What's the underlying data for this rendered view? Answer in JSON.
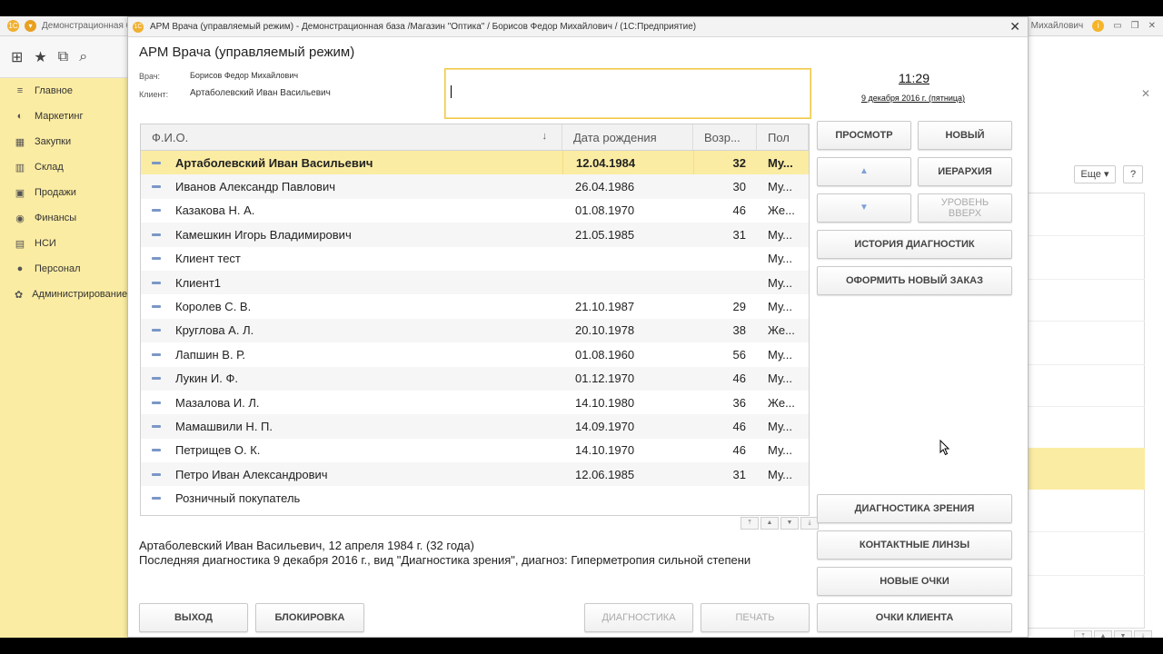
{
  "bg_window": {
    "title": "Демонстрационная б",
    "user": "Михайлович",
    "more": "Еще",
    "help": "?",
    "sidebar": [
      {
        "icon": "≡",
        "label": "Главное"
      },
      {
        "icon": "◐",
        "label": "Маркетинг"
      },
      {
        "icon": "▦",
        "label": "Закупки"
      },
      {
        "icon": "▥",
        "label": "Склад"
      },
      {
        "icon": "▣",
        "label": "Продажи"
      },
      {
        "icon": "◉",
        "label": "Финансы"
      },
      {
        "icon": "▤",
        "label": "НСИ"
      },
      {
        "icon": "●",
        "label": "Персонал"
      },
      {
        "icon": "✿",
        "label": "Администрирование"
      }
    ]
  },
  "modal": {
    "window_title": "АРМ Врача (управляемый режим) - Демонстрационная база /Магазин \"Оптика\" / Борисов Федор Михайлович /  (1С:Предприятие)",
    "form_title": "АРМ Врача (управляемый режим)",
    "doctor_label": "Врач:",
    "doctor_value": "Борисов Федор Михайлович",
    "client_label": "Клиент:",
    "client_value": "Артаболевский Иван Васильевич",
    "time": "11:29",
    "date": "9 декабря 2016 г. (пятница)"
  },
  "table": {
    "columns": [
      "Ф.И.О.",
      "Дата рождения",
      "Возр...",
      "Пол"
    ],
    "rows": [
      {
        "name": "Артаболевский Иван Васильевич",
        "birth": "12.04.1984",
        "age": "32",
        "sex": "Му...",
        "selected": true
      },
      {
        "name": "Иванов Александр Павлович",
        "birth": "26.04.1986",
        "age": "30",
        "sex": "Му..."
      },
      {
        "name": "Казакова Н. А.",
        "birth": "01.08.1970",
        "age": "46",
        "sex": "Же..."
      },
      {
        "name": "Камешкин Игорь Владимирович",
        "birth": "21.05.1985",
        "age": "31",
        "sex": "Му..."
      },
      {
        "name": "Клиент тест",
        "birth": "",
        "age": "",
        "sex": "Му..."
      },
      {
        "name": "Клиент1",
        "birth": "",
        "age": "",
        "sex": "Му..."
      },
      {
        "name": "Королев С. В.",
        "birth": "21.10.1987",
        "age": "29",
        "sex": "Му..."
      },
      {
        "name": "Круглова А. Л.",
        "birth": "20.10.1978",
        "age": "38",
        "sex": "Же..."
      },
      {
        "name": "Лапшин В. Р.",
        "birth": "01.08.1960",
        "age": "56",
        "sex": "Му..."
      },
      {
        "name": "Лукин И. Ф.",
        "birth": "01.12.1970",
        "age": "46",
        "sex": "Му..."
      },
      {
        "name": "Мазалова И. Л.",
        "birth": "14.10.1980",
        "age": "36",
        "sex": "Же..."
      },
      {
        "name": "Мамашвили Н. П.",
        "birth": "14.09.1970",
        "age": "46",
        "sex": "Му..."
      },
      {
        "name": "Петрищев О. К.",
        "birth": "14.10.1970",
        "age": "46",
        "sex": "Му..."
      },
      {
        "name": "Петро Иван Александрович",
        "birth": "12.06.1985",
        "age": "31",
        "sex": "Му..."
      },
      {
        "name": "Розничный покупатель",
        "birth": "",
        "age": "",
        "sex": ""
      }
    ]
  },
  "summary": {
    "line1": "Артаболевский Иван Васильевич, 12 апреля 1984 г. (32 года)",
    "line2": "Последняя диагностика 9 декабря 2016 г., вид \"Диагностика зрения\", диагноз: Гиперметропия сильной степени"
  },
  "buttons": {
    "view": "ПРОСМОТР",
    "new": "НОВЫЙ",
    "hierarchy": "ИЕРАРХИЯ",
    "level_up": "УРОВЕНЬ ВВЕРХ",
    "diag_history": "ИСТОРИЯ ДИАГНОСТИК",
    "new_order": "ОФОРМИТЬ НОВЫЙ ЗАКАЗ",
    "vision_diag": "ДИАГНОСТИКА ЗРЕНИЯ",
    "contact_lenses": "КОНТАКТНЫЕ ЛИНЗЫ",
    "new_glasses": "НОВЫЕ ОЧКИ",
    "client_glasses": "ОЧКИ КЛИЕНТА",
    "exit": "ВЫХОД",
    "block": "БЛОКИРОВКА",
    "diagnostics": "ДИАГНОСТИКА",
    "print": "ПЕЧАТЬ"
  }
}
